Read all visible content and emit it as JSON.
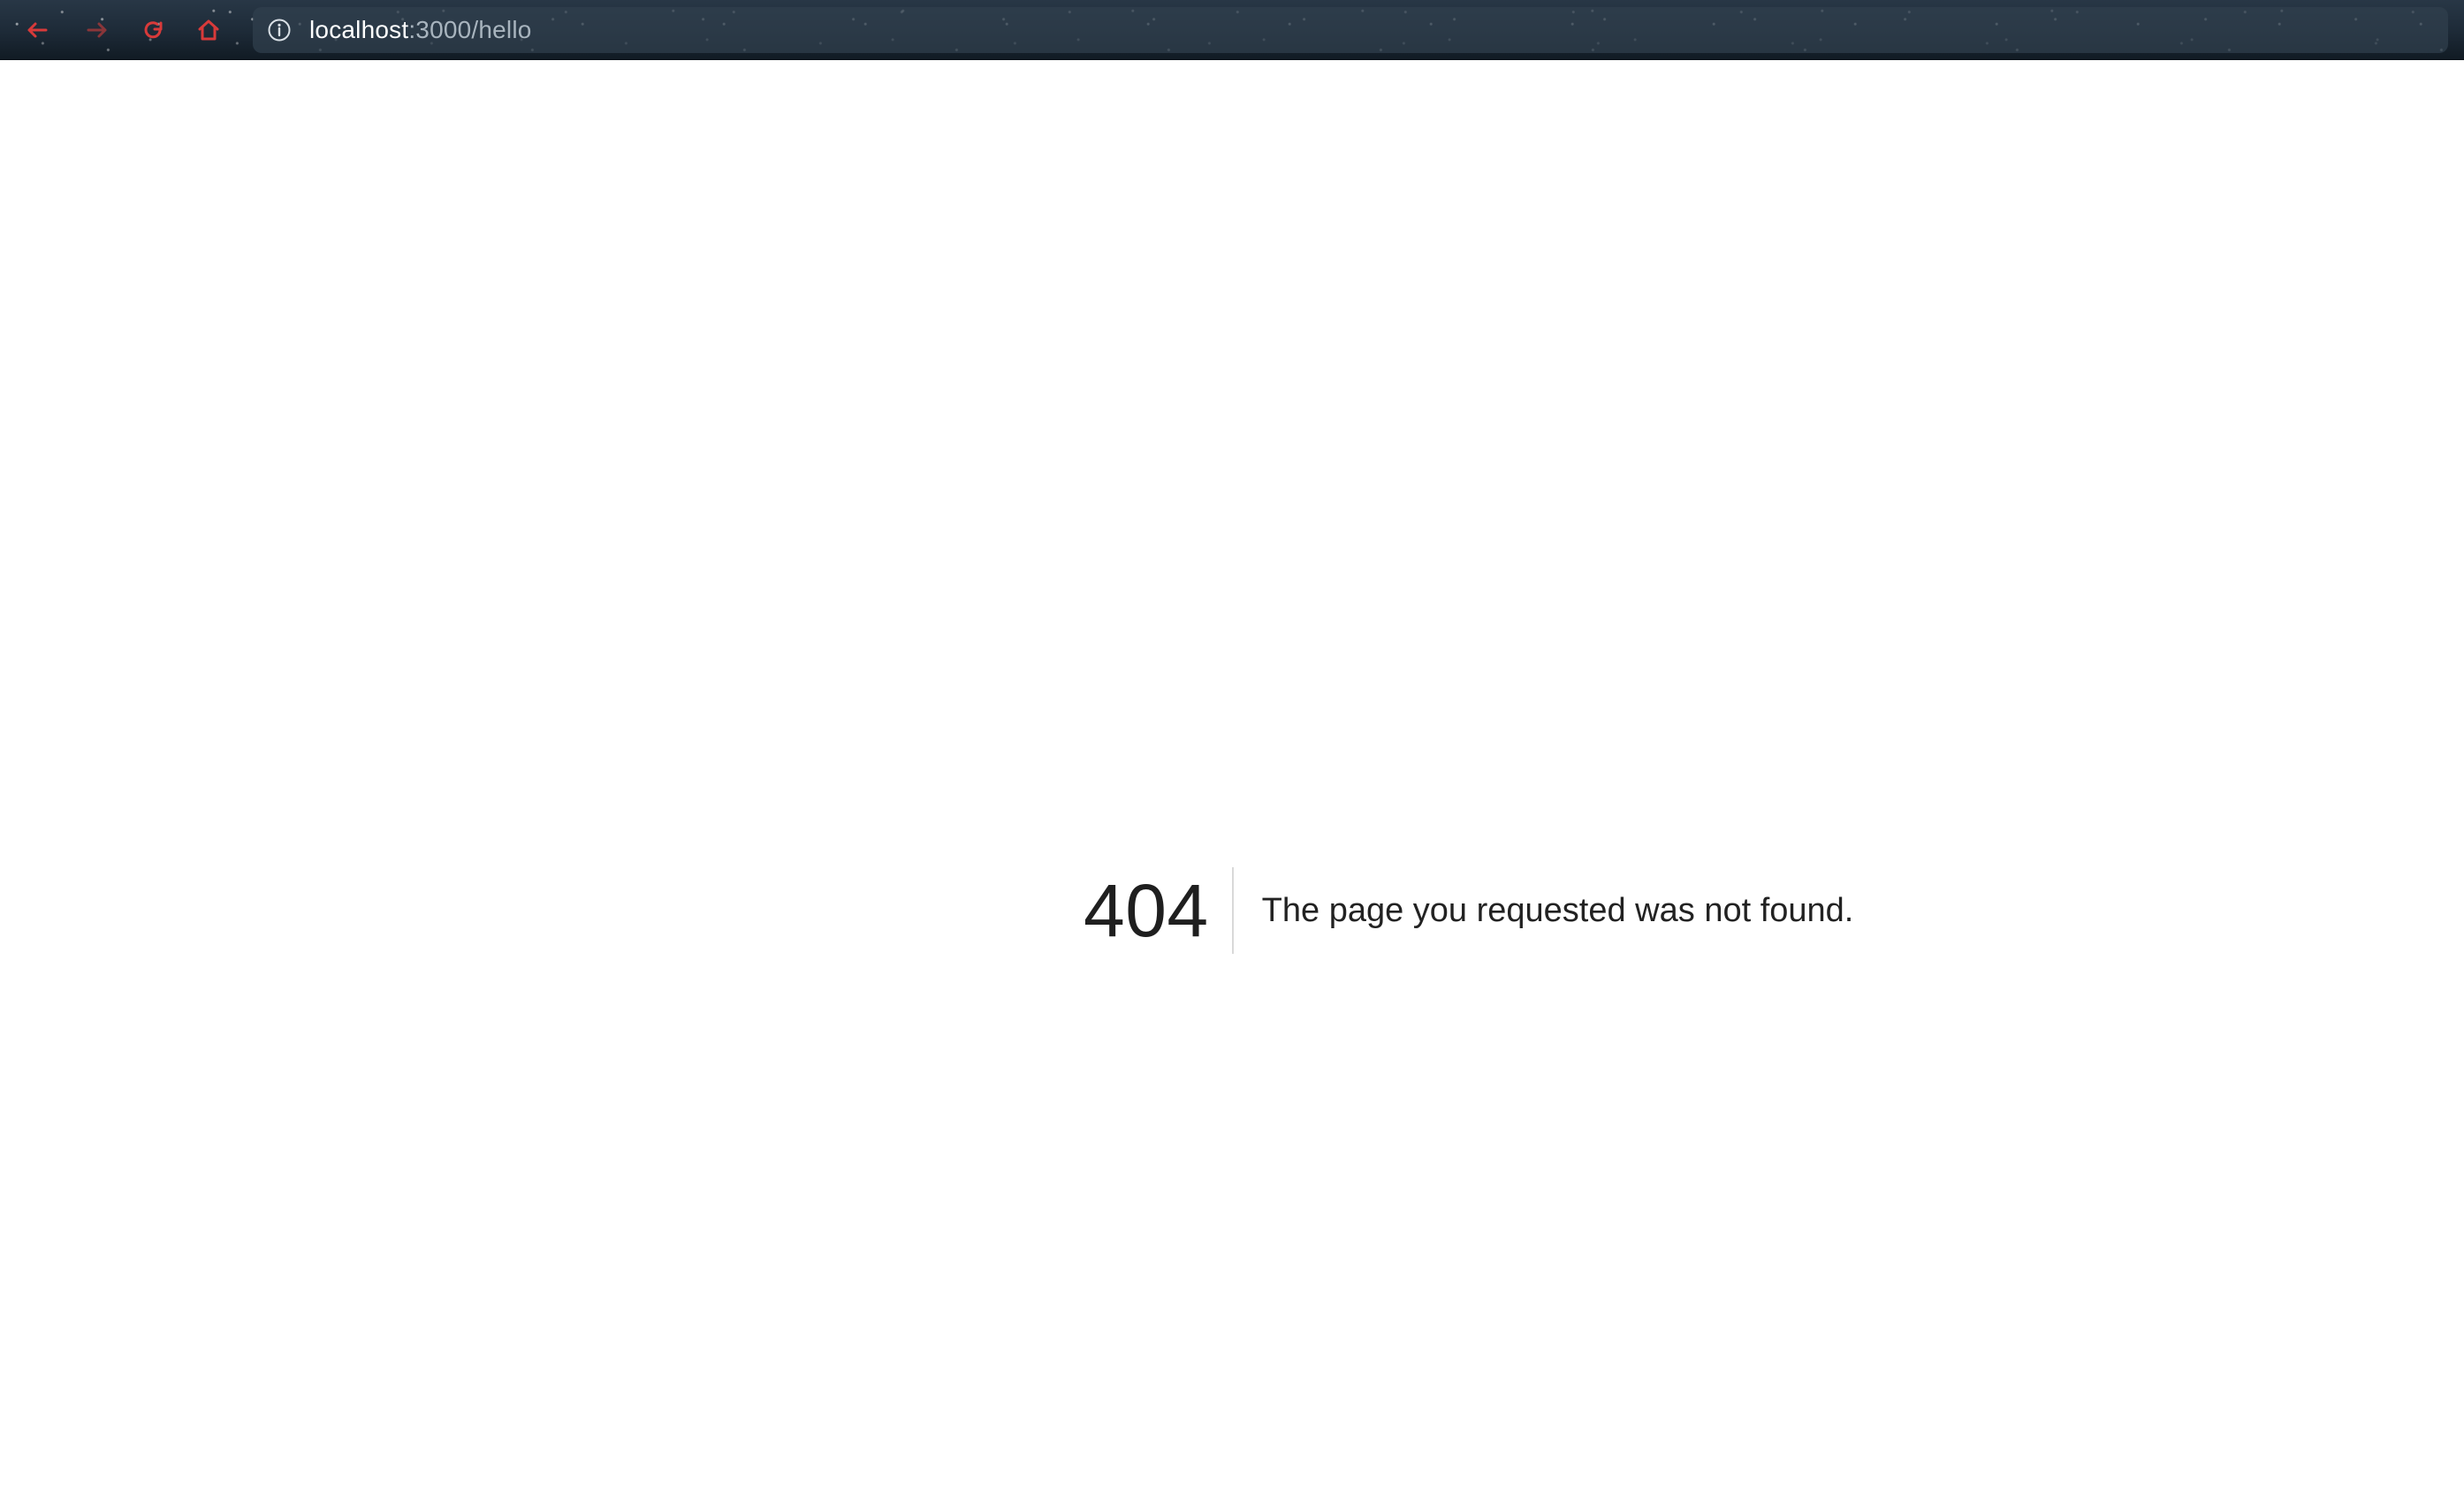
{
  "browser": {
    "url_host": "localhost",
    "url_rest": ":3000/hello",
    "icons": {
      "back": "back-arrow-icon",
      "forward": "forward-arrow-icon",
      "reload": "reload-icon",
      "home": "home-icon",
      "site_info": "info-circle-icon"
    },
    "colors": {
      "nav_icon": "#d83a3a",
      "toolbar": "#1f2d3a",
      "url_host": "#ffffff",
      "url_rest": "#a8b4be"
    }
  },
  "error_page": {
    "code": "404",
    "message": "The page you requested was not found.",
    "colors": {
      "text": "#222222",
      "divider": "#d9d9d9",
      "background": "#ffffff"
    }
  }
}
